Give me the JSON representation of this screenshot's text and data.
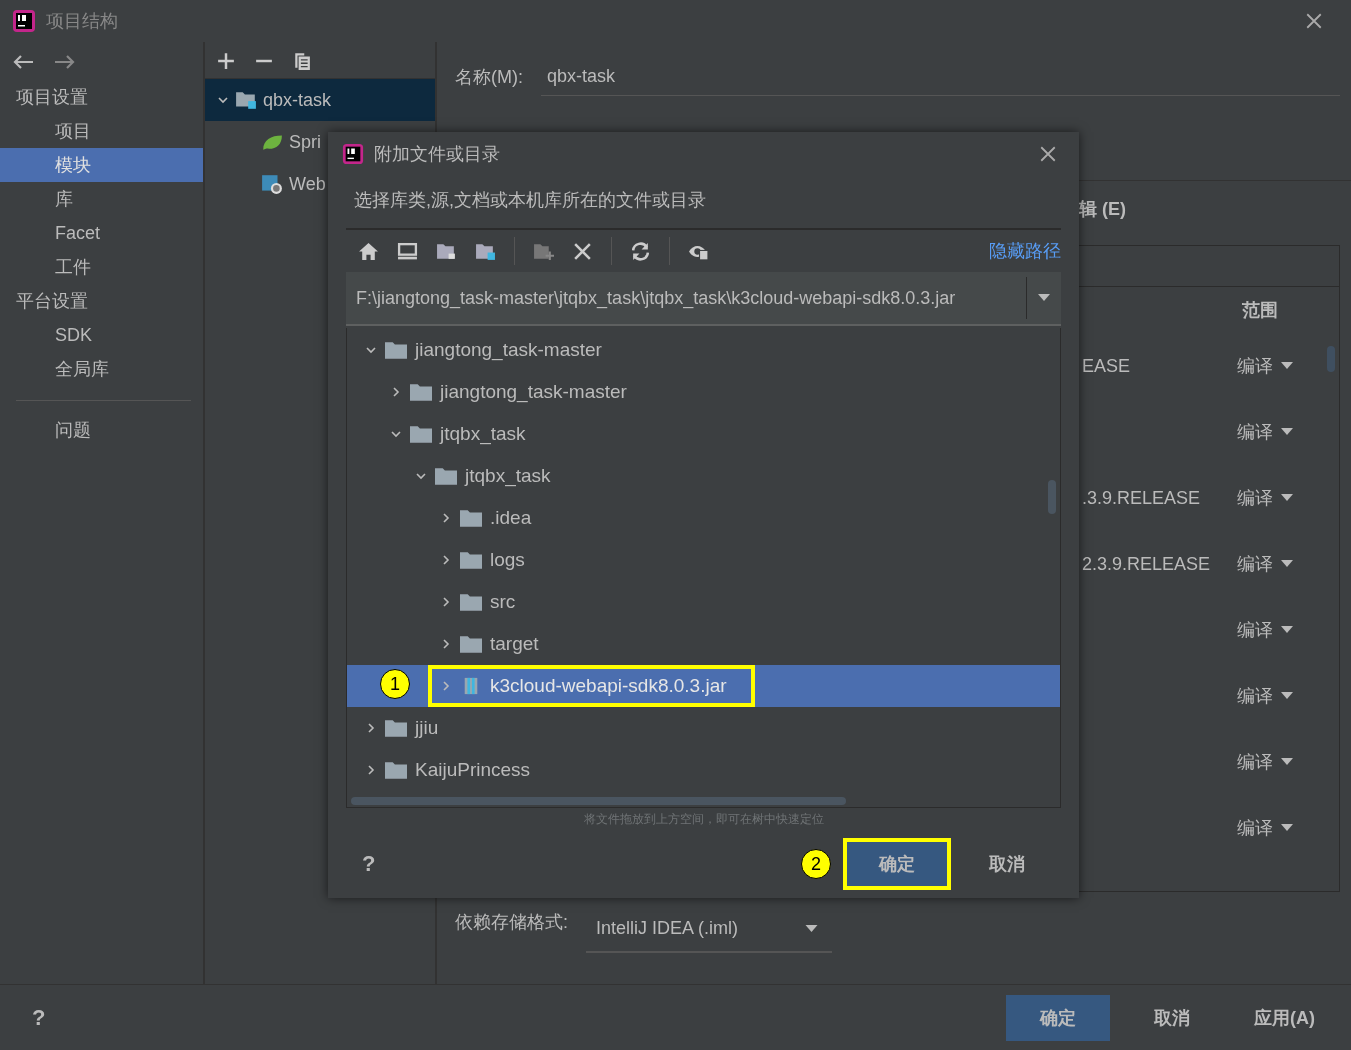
{
  "window": {
    "title": "项目结构"
  },
  "nav": {
    "sections": [
      {
        "title": "项目设置",
        "items": [
          {
            "label": "项目",
            "selected": false
          },
          {
            "label": "模块",
            "selected": true
          },
          {
            "label": "库",
            "selected": false
          },
          {
            "label": "Facet",
            "selected": false
          },
          {
            "label": "工件",
            "selected": false
          }
        ]
      },
      {
        "title": "平台设置",
        "items": [
          {
            "label": "SDK",
            "selected": false
          },
          {
            "label": "全局库",
            "selected": false
          }
        ]
      }
    ],
    "footer_items": [
      {
        "label": "问题",
        "selected": false
      }
    ]
  },
  "modules": {
    "items": [
      {
        "label": "qbx-task",
        "kind": "module",
        "expanded": true,
        "selected": true,
        "children": [
          {
            "label": "Spri",
            "kind": "spring",
            "selected": false
          },
          {
            "label": "Web",
            "kind": "web",
            "selected": false
          }
        ]
      }
    ]
  },
  "module_settings": {
    "name_label": "名称(M):",
    "name_value": "qbx-task",
    "editor_label": "辑 (E)",
    "table": {
      "columns": [
        {
          "label": "范围"
        }
      ],
      "rows": [
        {
          "library": "EASE",
          "scope": "编译"
        },
        {
          "scope": "编译"
        },
        {
          "library": ".3.9.RELEASE",
          "scope": "编译"
        },
        {
          "library": "2.3.9.RELEASE",
          "scope": "编译"
        },
        {
          "scope": "编译"
        },
        {
          "scope": "编译"
        },
        {
          "scope": "编译"
        },
        {
          "scope": "编译"
        }
      ]
    },
    "storage_format": {
      "label": "依赖存储格式:",
      "value": "IntelliJ IDEA (.iml)"
    }
  },
  "dialog": {
    "title": "附加文件或目录",
    "description": "选择库类,源,文档或本机库所在的文件或目录",
    "toggle_link": "隐藏路径",
    "path": "F:\\jiangtong_task-master\\jtqbx_task\\jtqbx_task\\k3cloud-webapi-sdk8.0.3.jar",
    "tree": [
      {
        "label": "jiangtong_task-master",
        "kind": "folder",
        "expanded": true,
        "selected": false,
        "children": [
          {
            "label": "jiangtong_task-master",
            "kind": "folder",
            "expanded": false,
            "selected": false
          },
          {
            "label": "jtqbx_task",
            "kind": "folder",
            "expanded": true,
            "selected": false,
            "children": [
              {
                "label": "jtqbx_task",
                "kind": "folder",
                "expanded": true,
                "selected": false,
                "children": [
                  {
                    "label": ".idea",
                    "kind": "folder",
                    "expanded": false,
                    "selected": false
                  },
                  {
                    "label": "logs",
                    "kind": "folder",
                    "expanded": false,
                    "selected": false
                  },
                  {
                    "label": "src",
                    "kind": "folder",
                    "expanded": false,
                    "selected": false
                  },
                  {
                    "label": "target",
                    "kind": "folder",
                    "expanded": false,
                    "selected": false
                  },
                  {
                    "label": "k3cloud-webapi-sdk8.0.3.jar",
                    "kind": "jar",
                    "expanded": false,
                    "selected": true,
                    "callout": "1"
                  }
                ]
              }
            ]
          }
        ]
      },
      {
        "label": "jjiu",
        "kind": "folder",
        "expanded": false,
        "selected": false
      },
      {
        "label": "KaijuPrincess",
        "kind": "folder",
        "expanded": false,
        "selected": false
      }
    ],
    "hint": "将文件拖放到上方空间，即可在树中快速定位",
    "help": "?",
    "buttons": [
      {
        "label": "确定",
        "kind": "primary",
        "callout": "2"
      },
      {
        "label": "取消",
        "kind": "plain"
      }
    ]
  },
  "help": "?",
  "buttons": [
    {
      "label": "确定",
      "kind": "primary"
    },
    {
      "label": "取消",
      "kind": "plain"
    },
    {
      "label": "应用(A)",
      "kind": "plain"
    }
  ]
}
